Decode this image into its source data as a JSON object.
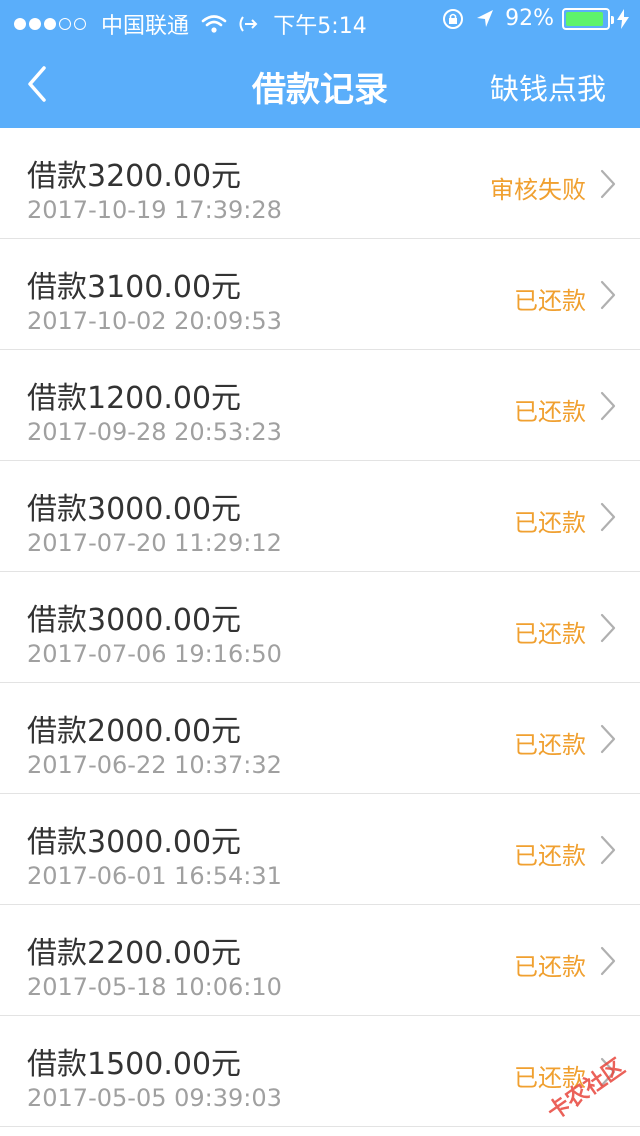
{
  "status_bar": {
    "carrier": "中国联通",
    "time": "下午5:14",
    "battery_percent": "92%",
    "battery_level": 0.92,
    "signal_bars_filled": 3,
    "signal_bars_total": 5
  },
  "nav": {
    "title": "借款记录",
    "action": "缺钱点我"
  },
  "colors": {
    "header": "#5aaefa",
    "status_text": "#f0a030",
    "battery_fill": "#5ef36b"
  },
  "records": [
    {
      "title": "借款3200.00元",
      "time": "2017-10-19 17:39:28",
      "status": "审核失败"
    },
    {
      "title": "借款3100.00元",
      "time": "2017-10-02 20:09:53",
      "status": "已还款"
    },
    {
      "title": "借款1200.00元",
      "time": "2017-09-28 20:53:23",
      "status": "已还款"
    },
    {
      "title": "借款3000.00元",
      "time": "2017-07-20 11:29:12",
      "status": "已还款"
    },
    {
      "title": "借款3000.00元",
      "time": "2017-07-06 19:16:50",
      "status": "已还款"
    },
    {
      "title": "借款2000.00元",
      "time": "2017-06-22 10:37:32",
      "status": "已还款"
    },
    {
      "title": "借款3000.00元",
      "time": "2017-06-01 16:54:31",
      "status": "已还款"
    },
    {
      "title": "借款2200.00元",
      "time": "2017-05-18 10:06:10",
      "status": "已还款"
    },
    {
      "title": "借款1500.00元",
      "time": "2017-05-05 09:39:03",
      "status": "已还款"
    }
  ],
  "watermark": {
    "text": "卡农社区"
  }
}
